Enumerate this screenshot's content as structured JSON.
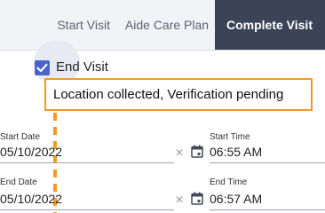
{
  "tabs": [
    {
      "label": "Start Visit"
    },
    {
      "label": "Aide Care Plan"
    },
    {
      "label": "Complete Visit"
    }
  ],
  "colors": {
    "active_tab_bg": "#3a4456",
    "checkbox_accent": "#4a64c9",
    "highlight_orange": "#f39a23"
  },
  "end_visit": {
    "label": "End Visit",
    "checked": true
  },
  "status_message": "Location collected, Verification pending",
  "fields": {
    "start_date": {
      "label": "Start Date",
      "value": "05/10/2022"
    },
    "start_time": {
      "label": "Start Time",
      "value": "06:55 AM"
    },
    "end_date": {
      "label": "End Date",
      "value": "05/10/2022"
    },
    "end_time": {
      "label": "End Time",
      "value": "06:57 AM"
    }
  },
  "icons": {
    "clear": "close-icon",
    "calendar": "calendar-icon"
  }
}
